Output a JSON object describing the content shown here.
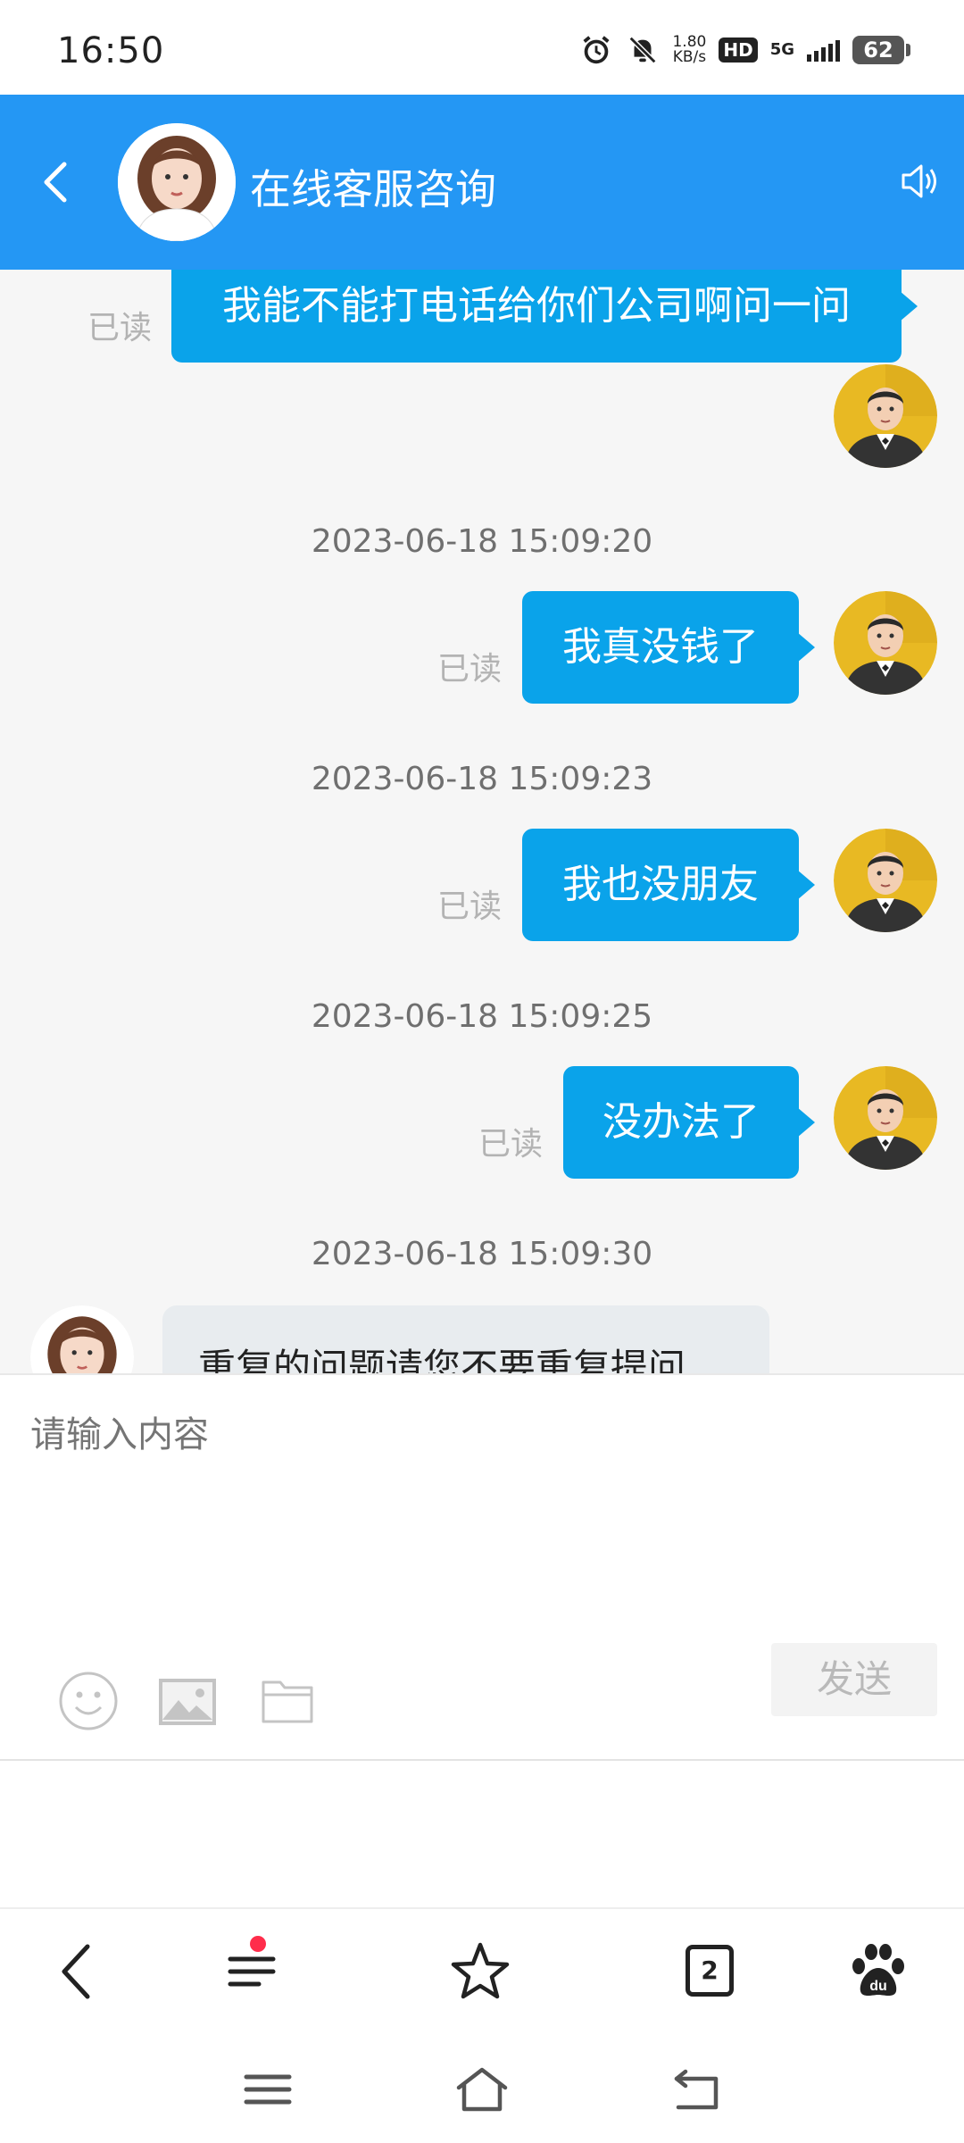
{
  "status_bar": {
    "time": "16:50",
    "net_speed_value": "1.80",
    "net_speed_unit": "KB/s",
    "hd_label": "HD",
    "network": "5G",
    "battery": "62"
  },
  "header": {
    "title": "在线客服咨询"
  },
  "messages": [
    {
      "text": "我能不能打电话给你们公司啊问一问",
      "status": "已读"
    },
    {
      "timestamp": "2023-06-18 15:09:20",
      "text": "我真没钱了",
      "status": "已读"
    },
    {
      "timestamp": "2023-06-18 15:09:23",
      "text": "我也没朋友",
      "status": "已读"
    },
    {
      "timestamp": "2023-06-18 15:09:25",
      "text": "没办法了",
      "status": "已读"
    },
    {
      "timestamp": "2023-06-18 15:09:30",
      "text": "重复的问题请您不要重复提问"
    }
  ],
  "composer": {
    "placeholder": "请输入内容",
    "send_label": "发送"
  },
  "browser_bar": {
    "tab_count": "2"
  },
  "colors": {
    "header": "#2497f4",
    "outgoing_bubble": "#0aa3ea",
    "notification_dot": "#ff2d4b"
  }
}
